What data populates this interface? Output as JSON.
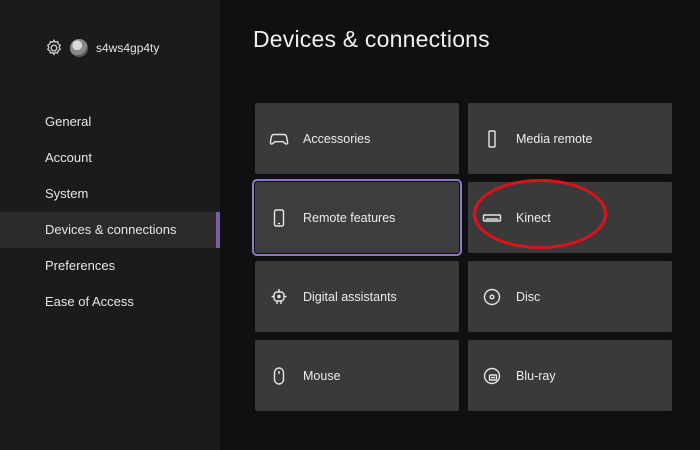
{
  "profile": {
    "username": "s4ws4gp4ty"
  },
  "nav": {
    "items": [
      {
        "label": "General"
      },
      {
        "label": "Account"
      },
      {
        "label": "System"
      },
      {
        "label": "Devices & connections",
        "active": true
      },
      {
        "label": "Preferences"
      },
      {
        "label": "Ease of Access"
      }
    ]
  },
  "page": {
    "title": "Devices & connections"
  },
  "tiles": [
    {
      "label": "Accessories",
      "icon": "gamepad-icon"
    },
    {
      "label": "Media remote",
      "icon": "remote-icon"
    },
    {
      "label": "Remote features",
      "icon": "phone-icon",
      "focused": true
    },
    {
      "label": "Kinect",
      "icon": "kinect-icon"
    },
    {
      "label": "Digital assistants",
      "icon": "assistant-icon"
    },
    {
      "label": "Disc",
      "icon": "disc-icon"
    },
    {
      "label": "Mouse",
      "icon": "mouse-icon"
    },
    {
      "label": "Blu-ray",
      "icon": "bluray-icon"
    }
  ],
  "colors": {
    "accent": "#8f79c7",
    "annotation": "#e0101a",
    "tile": "#3a3a3a",
    "sidebar": "#1b1b1b",
    "background": "#101010"
  }
}
